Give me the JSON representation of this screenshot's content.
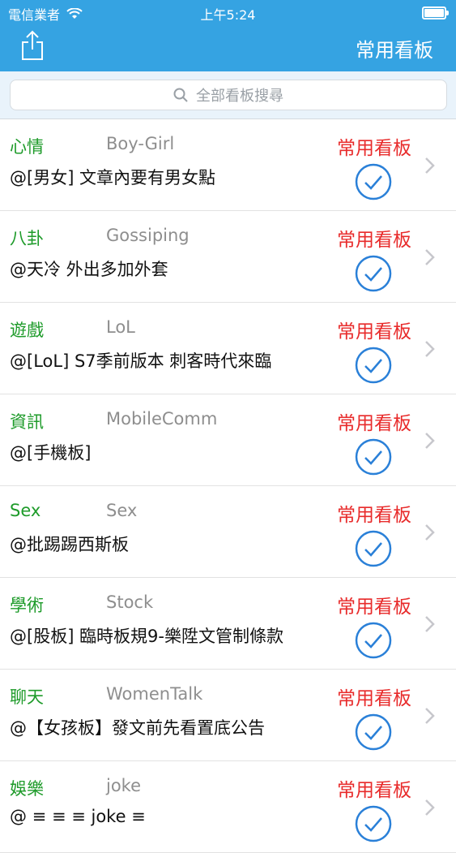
{
  "status_bar": {
    "carrier": "電信業者",
    "time": "上午5:24"
  },
  "nav": {
    "title": "常用看板"
  },
  "search": {
    "placeholder": "全部看板搜尋"
  },
  "rows": [
    {
      "category": "心情",
      "board": "Boy-Girl",
      "tag": "常用看板",
      "desc": "@[男女] 文章內要有男女點"
    },
    {
      "category": "八卦",
      "board": "Gossiping",
      "tag": "常用看板",
      "desc": "@天冷 外出多加外套"
    },
    {
      "category": "遊戲",
      "board": "LoL",
      "tag": "常用看板",
      "desc": "@[LoL] S7季前版本 刺客時代來臨"
    },
    {
      "category": "資訊",
      "board": "MobileComm",
      "tag": "常用看板",
      "desc": "@[手機板]"
    },
    {
      "category": "Sex",
      "board": "Sex",
      "tag": "常用看板",
      "desc": "@批踢踢西斯板"
    },
    {
      "category": "學術",
      "board": "Stock",
      "tag": "常用看板",
      "desc": "@[股板] 臨時板規9-樂陞文管制條款"
    },
    {
      "category": "聊天",
      "board": "WomenTalk",
      "tag": "常用看板",
      "desc": "@【女孩板】發文前先看置底公告"
    },
    {
      "category": "娛樂",
      "board": "joke",
      "tag": "常用看板",
      "desc": "@ ≡ ≡ ≡ joke ≡"
    }
  ],
  "colors": {
    "nav_bg": "#35a3e2",
    "category": "#1e9b2a",
    "tag": "#e82b2b",
    "check": "#2a80d8"
  }
}
